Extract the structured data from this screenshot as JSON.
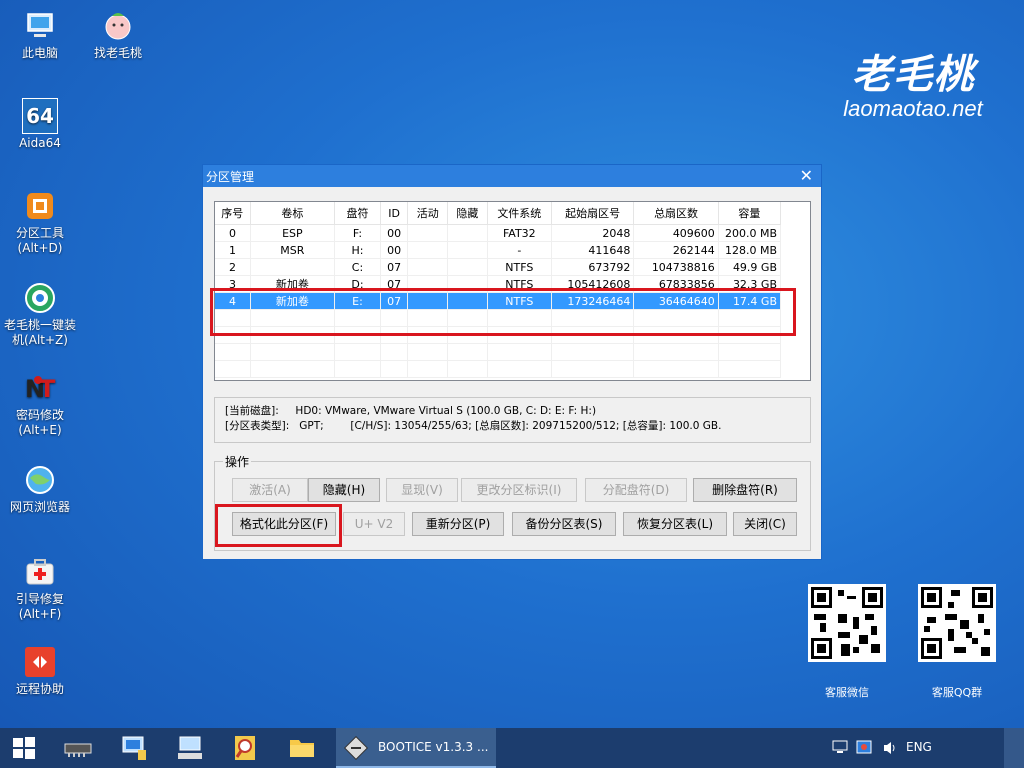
{
  "desktop_icons": [
    {
      "label_l1": "此电脑",
      "label_l2": ""
    },
    {
      "label_l1": "找老毛桃",
      "label_l2": ""
    },
    {
      "label_l1": "Aida64",
      "label_l2": "",
      "glyph": "64"
    },
    {
      "label_l1": "分区工具",
      "label_l2": "(Alt+D)"
    },
    {
      "label_l1": "老毛桃一键装",
      "label_l2": "机(Alt+Z)"
    },
    {
      "label_l1": "密码修改",
      "label_l2": "(Alt+E)"
    },
    {
      "label_l1": "网页浏览器",
      "label_l2": ""
    },
    {
      "label_l1": "引导修复",
      "label_l2": "(Alt+F)"
    },
    {
      "label_l1": "远程协助",
      "label_l2": ""
    }
  ],
  "brand": {
    "name": "老毛桃",
    "url": "laomaotao.net"
  },
  "qr": [
    {
      "label": "客服微信"
    },
    {
      "label": "客服QQ群"
    }
  ],
  "window": {
    "title": "分区管理",
    "columns": [
      "序号",
      "卷标",
      "盘符",
      "ID",
      "活动",
      "隐藏",
      "文件系统",
      "起始扇区号",
      "总扇区数",
      "容量"
    ],
    "rows": [
      [
        "0",
        "ESP",
        "F:",
        "00",
        "",
        "",
        "FAT32",
        "2048",
        "409600",
        "200.0 MB"
      ],
      [
        "1",
        "MSR",
        "H:",
        "00",
        "",
        "",
        "-",
        "411648",
        "262144",
        "128.0 MB"
      ],
      [
        "2",
        "",
        "C:",
        "07",
        "",
        "",
        "NTFS",
        "673792",
        "104738816",
        "49.9 GB"
      ],
      [
        "3",
        "新加卷",
        "D:",
        "07",
        "",
        "",
        "NTFS",
        "105412608",
        "67833856",
        "32.3 GB"
      ],
      [
        "4",
        "新加卷",
        "E:",
        "07",
        "",
        "",
        "NTFS",
        "173246464",
        "36464640",
        "17.4 GB"
      ]
    ],
    "selected_row": 4,
    "info_line1": "[当前磁盘]:     HD0: VMware, VMware Virtual S (100.0 GB, C: D: E: F: H:)",
    "info_line2": "[分区表类型]:   GPT;        [C/H/S]: 13054/255/63; [总扇区数]: 209715200/512; [总容量]: 100.0 GB.",
    "ops_title": "操作",
    "buttons": {
      "activate": "激活(A)",
      "hide": "隐藏(H)",
      "show": "显现(V)",
      "change_id": "更改分区标识(I)",
      "assign_letter": "分配盘符(D)",
      "remove_letter": "删除盘符(R)",
      "format": "格式化此分区(F)",
      "uv2": "U+ V2",
      "repartition": "重新分区(P)",
      "backup_table": "备份分区表(S)",
      "restore_table": "恢复分区表(L)",
      "close": "关闭(C)"
    }
  },
  "taskbar": {
    "active_app": "BOOTICE v1.3.3 ...",
    "lang": "ENG"
  },
  "colors": {
    "selection": "#3399ff",
    "highlight_box": "#d9161e",
    "titlebar": "#2d7fde"
  }
}
